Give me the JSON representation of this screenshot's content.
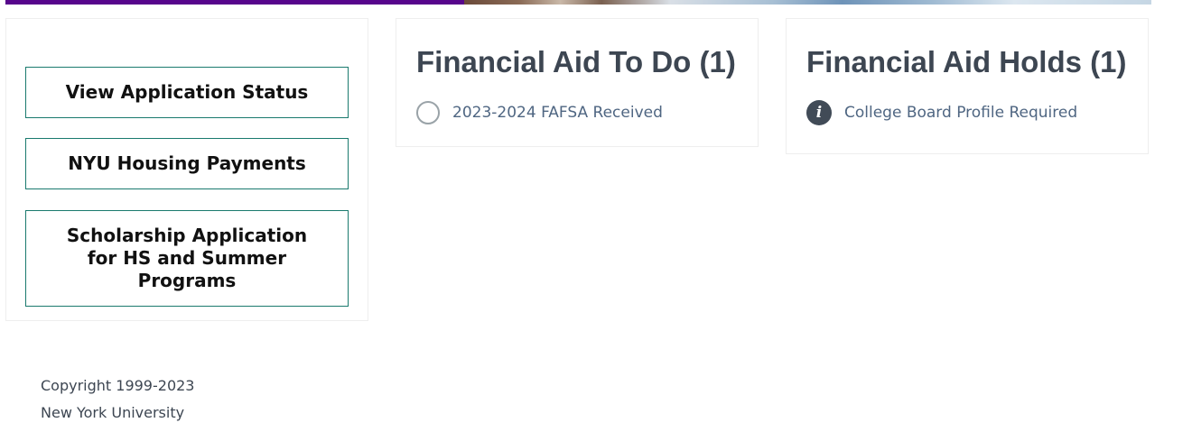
{
  "links": {
    "view_application_status": "View Application Status",
    "housing_payments": "NYU Housing Payments",
    "scholarship_application": "Scholarship Application for HS and Summer Programs"
  },
  "financial_aid_todo": {
    "title": "Financial Aid To Do (1)",
    "items": [
      {
        "label": "2023-2024 FAFSA Received",
        "icon": "empty-circle-icon"
      }
    ]
  },
  "financial_aid_holds": {
    "title": "Financial Aid Holds (1)",
    "items": [
      {
        "label": "College Board Profile Required",
        "icon": "info-icon"
      }
    ]
  },
  "footer": {
    "copyright": "Copyright 1999-2023",
    "organization": "New York University"
  },
  "colors": {
    "brand_purple": "#57068c",
    "button_border": "#1a7a6e",
    "title_text": "#3d4652",
    "item_text": "#4f6682"
  }
}
